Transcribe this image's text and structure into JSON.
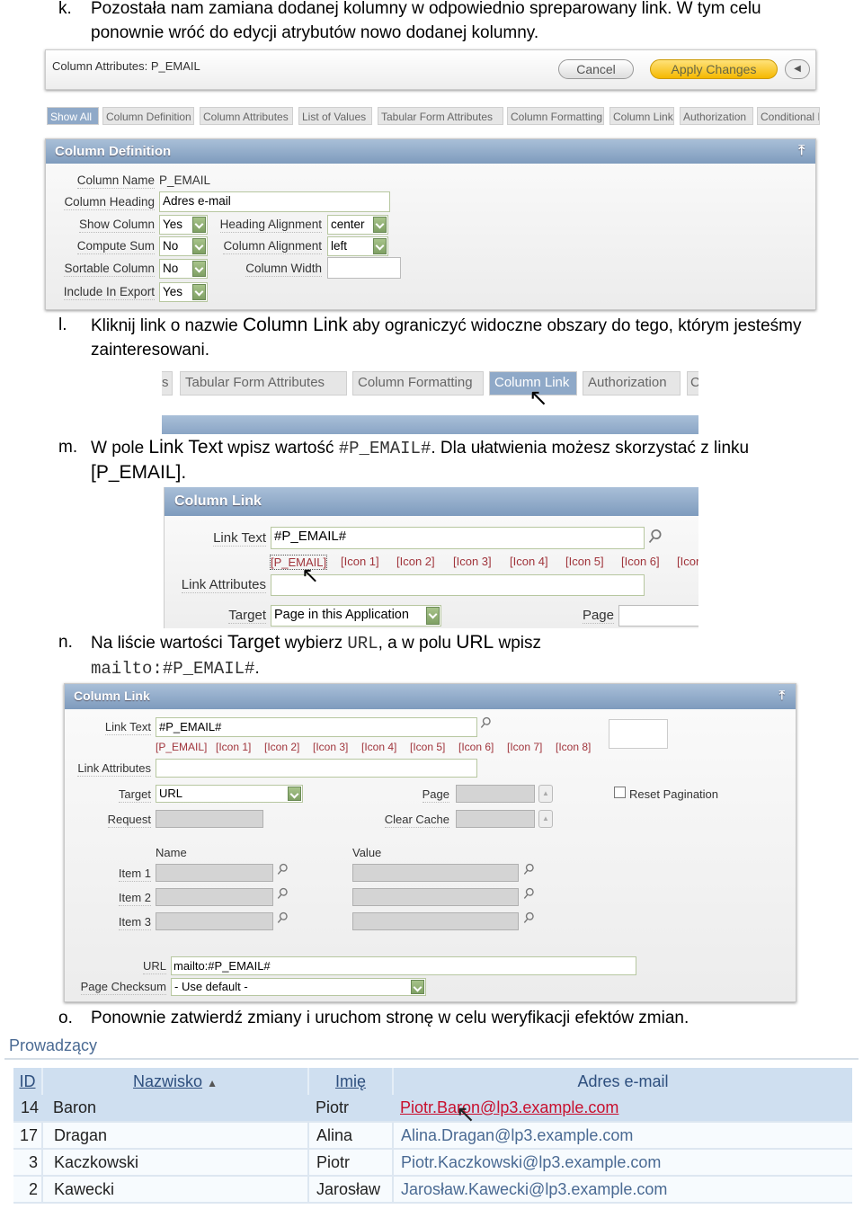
{
  "steps": {
    "k": {
      "marker": "k.",
      "line1": "Pozostała nam zamiana dodanej kolumny w odpowiednio spreparowany link. W tym celu",
      "line2": "ponownie wróć do edycji atrybutów nowo dodanej kolumny."
    },
    "l": {
      "marker": "l.",
      "pre": "Kliknij link o nazwie ",
      "ui": "Column Link",
      "post": " aby ograniczyć widoczne obszary do tego, którym jesteśmy",
      "line2": "zainteresowani."
    },
    "m": {
      "marker": "m.",
      "pre": "W pole ",
      "ui": "Link Text",
      "mid": " wpisz wartość ",
      "code": "#P_EMAIL#",
      "post": ". Dla ułatwienia możesz skorzystać z linku",
      "line2": "[P_EMAIL]."
    },
    "n": {
      "marker": "n.",
      "pre": "Na liście wartości ",
      "ui": "Target",
      "mid": " wybierz ",
      "code": "URL",
      "mid2": ", a w polu ",
      "ui2": "URL",
      "post": " wpisz",
      "code2": "mailto:#P_EMAIL#",
      "end": "."
    },
    "o": {
      "marker": "o.",
      "text": "Ponownie zatwierdź zmiany i uruchom stronę w celu weryfikacji efektów zmian."
    }
  },
  "shot1": {
    "title": "Column Attributes: P_EMAIL",
    "cancel": "Cancel",
    "apply": "Apply Changes",
    "tabs": [
      "Show All",
      "Column Definition",
      "Column Attributes",
      "List of Values",
      "Tabular Form Attributes",
      "Column Formatting",
      "Column Link",
      "Authorization",
      "Conditional I"
    ],
    "panel_title": "Column Definition",
    "column_name_label": "Column Name",
    "column_name": "P_EMAIL",
    "column_heading_label": "Column Heading",
    "column_heading": "Adres e-mail",
    "show_column_label": "Show Column",
    "show_column": "Yes",
    "compute_sum_label": "Compute Sum",
    "compute_sum": "No",
    "sortable_label": "Sortable Column",
    "sortable": "No",
    "export_label": "Include In Export",
    "export": "Yes",
    "heading_align_label": "Heading Alignment",
    "heading_align": "center",
    "column_align_label": "Column Alignment",
    "column_align": "left",
    "column_width_label": "Column Width",
    "column_width": ""
  },
  "shot2": {
    "tabs": [
      "s",
      "Tabular Form Attributes",
      "Column Formatting",
      "Column Link",
      "Authorization",
      "C"
    ],
    "active": "Column Link"
  },
  "shot3": {
    "panel_title": "Column Link",
    "link_text_label": "Link Text",
    "link_text": "#P_EMAIL#",
    "icon_links": [
      "[P_EMAIL]",
      "[Icon 1]",
      "[Icon 2]",
      "[Icon 3]",
      "[Icon 4]",
      "[Icon 5]",
      "[Icon 6]",
      "[Icor"
    ],
    "link_attr_label": "Link Attributes",
    "target_label": "Target",
    "target": "Page in this Application",
    "page_label": "Page"
  },
  "shot4": {
    "panel_title": "Column Link",
    "link_text_label": "Link Text",
    "link_text": "#P_EMAIL#",
    "icon_links": [
      "[P_EMAIL]",
      "[Icon 1]",
      "[Icon 2]",
      "[Icon 3]",
      "[Icon 4]",
      "[Icon 5]",
      "[Icon 6]",
      "[Icon 7]",
      "[Icon 8]"
    ],
    "link_attr_label": "Link Attributes",
    "target_label": "Target",
    "target": "URL",
    "request_label": "Request",
    "page_label": "Page",
    "clear_cache_label": "Clear Cache",
    "reset_pagination": "Reset Pagination",
    "name_header": "Name",
    "value_header": "Value",
    "items": [
      "Item 1",
      "Item 2",
      "Item 3"
    ],
    "url_label": "URL",
    "url": "mailto:#P_EMAIL#",
    "checksum_label": "Page Checksum",
    "checksum": "- Use default -"
  },
  "report": {
    "title": "Prowadzący",
    "columns": [
      "ID",
      "Nazwisko",
      "Imię",
      "Adres e-mail"
    ],
    "rows": [
      [
        "14",
        "Baron",
        "Piotr",
        "Piotr.Baron@lp3.example.com"
      ],
      [
        "17",
        "Dragan",
        "Alina",
        "Alina.Dragan@lp3.example.com"
      ],
      [
        "3",
        "Kaczkowski",
        "Piotr",
        "Piotr.Kaczkowski@lp3.example.com"
      ],
      [
        "2",
        "Kawecki",
        "Jarosław",
        "Jarosław.Kawecki@lp3.example.com"
      ]
    ]
  },
  "colors": {
    "panel_header": "#8fa9c8",
    "apply_button": "#f5c842",
    "link_red": "#c8102e",
    "link_blue": "#2e4f7e",
    "icon_link": "#a0343b"
  }
}
